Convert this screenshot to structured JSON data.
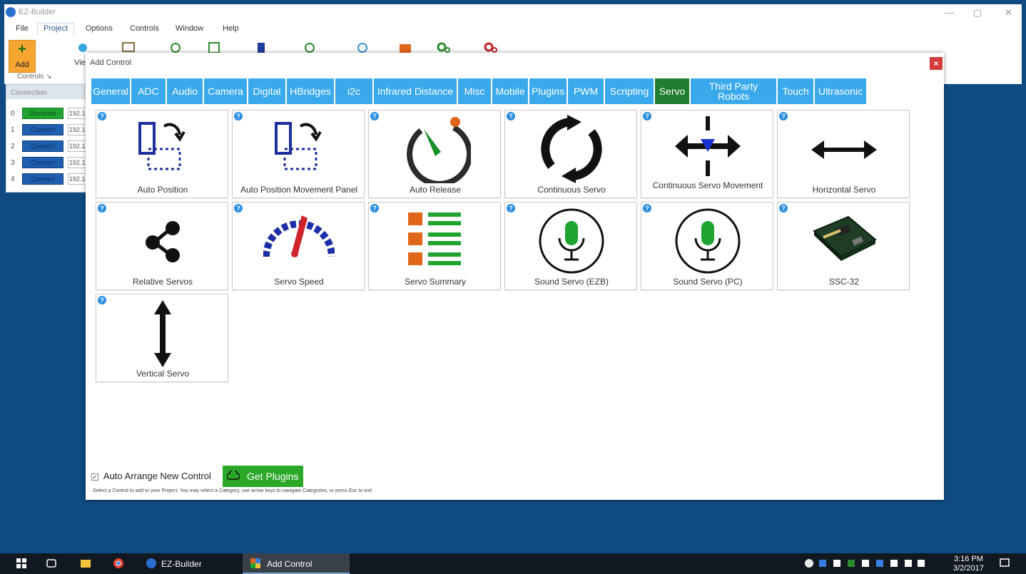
{
  "app": {
    "title": "EZ-Builder",
    "window_controls": [
      "—",
      "▢",
      "✕"
    ],
    "menu": [
      "File",
      "Project",
      "Options",
      "Controls",
      "Window",
      "Help"
    ],
    "ribbon": {
      "add_label": "Add",
      "view_label": "Vie",
      "group_label": "Controls ↘"
    },
    "connection": {
      "title": "Connection",
      "rows": [
        {
          "num": "0",
          "button": "Disconne",
          "ip": "192.1"
        },
        {
          "num": "1",
          "button": "Connect",
          "ip": "192.1"
        },
        {
          "num": "2",
          "button": "Connect",
          "ip": "192.1"
        },
        {
          "num": "3",
          "button": "Connect",
          "ip": "192.1"
        },
        {
          "num": "4",
          "button": "Connect",
          "ip": "192.1"
        }
      ]
    }
  },
  "dialog": {
    "title": "Add Control",
    "close": "×",
    "tabs": [
      "General",
      "ADC",
      "Audio",
      "Camera",
      "Digital",
      "HBridges",
      "i2c",
      "Infrared Distance",
      "Misc",
      "Mobile",
      "Plugins",
      "PWM",
      "Scripting",
      "Servo",
      "Third Party Robots",
      "Touch",
      "Ultrasonic"
    ],
    "active_tab": "Servo",
    "controls": [
      {
        "label": "Auto Position",
        "icon": "auto-position-icon"
      },
      {
        "label": "Auto Position Movement Panel",
        "icon": "auto-position-panel-icon"
      },
      {
        "label": "Auto Release",
        "icon": "auto-release-icon"
      },
      {
        "label": "Continuous Servo",
        "icon": "continuous-servo-icon"
      },
      {
        "label": "Continuous Servo Movement",
        "icon": "continuous-servo-movement-icon"
      },
      {
        "label": "Horizontal Servo",
        "icon": "horizontal-arrow-icon"
      },
      {
        "label": "Relative Servos",
        "icon": "share-icon"
      },
      {
        "label": "Servo Speed",
        "icon": "speedometer-icon"
      },
      {
        "label": "Servo Summary",
        "icon": "list-summary-icon"
      },
      {
        "label": "Sound Servo (EZB)",
        "icon": "microphone-icon"
      },
      {
        "label": "Sound Servo (PC)",
        "icon": "microphone-icon"
      },
      {
        "label": "SSC-32",
        "icon": "circuit-board-icon"
      },
      {
        "label": "Vertical Servo",
        "icon": "vertical-arrow-icon"
      }
    ],
    "auto_arrange_label": "Auto Arrange New Control",
    "auto_arrange_checked": true,
    "get_plugins_label": "Get Plugins",
    "help_text": "Select a Control to add to your Project. You may select a Category, use arrow keys to navigate Categories, or press Esc to exit"
  },
  "taskbar": {
    "apps": [
      "EZ-Builder",
      "Add Control"
    ],
    "time": "3:16 PM",
    "date": "3/2/2017"
  },
  "colors": {
    "tab": "#39a9ec",
    "tab_active": "#1e7d2e",
    "desktop": "#0f4a82",
    "get_plugins": "#2ba828"
  }
}
